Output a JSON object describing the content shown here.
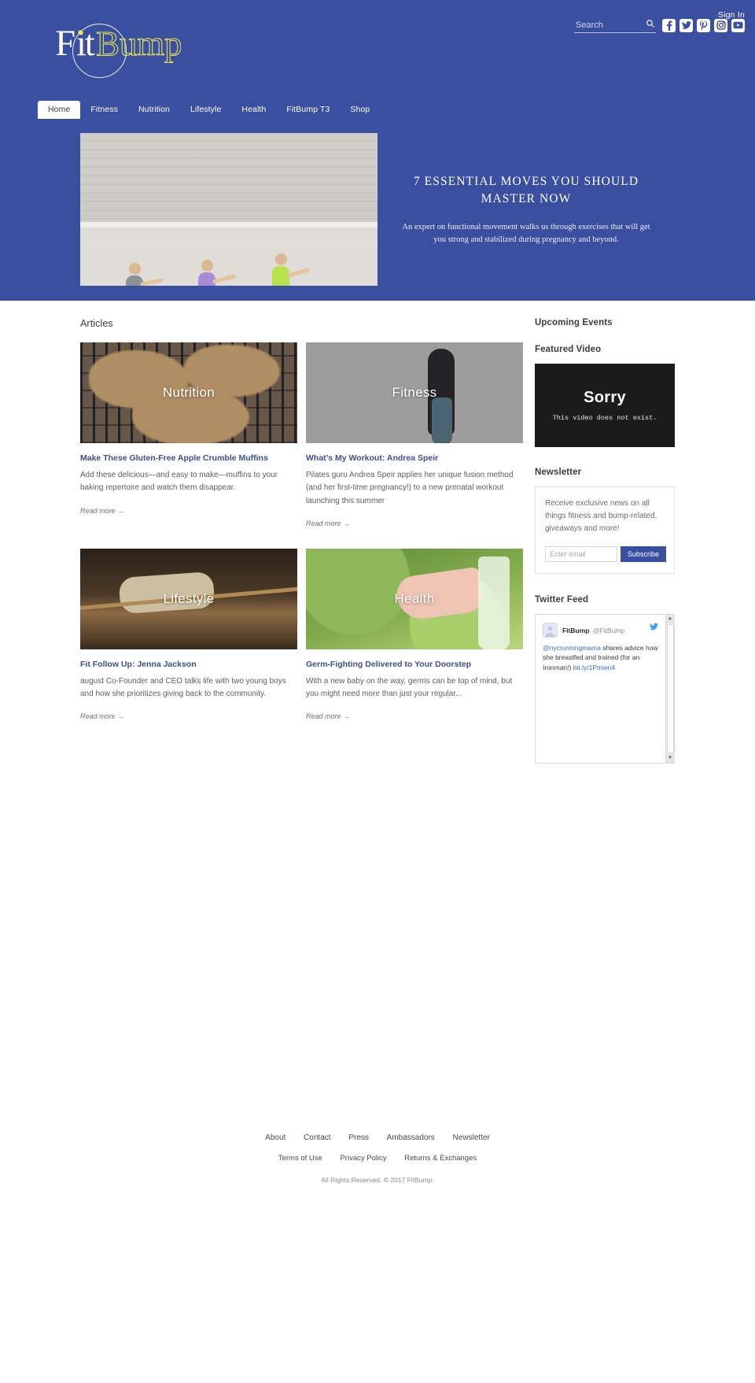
{
  "header": {
    "sign_in": "Sign In",
    "search_placeholder": "Search",
    "search_value": "",
    "search_icon": "search-icon",
    "logo_fit": "Fit",
    "logo_bump": "Bump",
    "social": [
      {
        "name": "facebook-icon",
        "label": "Facebook"
      },
      {
        "name": "twitter-icon",
        "label": "Twitter"
      },
      {
        "name": "pinterest-icon",
        "label": "Pinterest"
      },
      {
        "name": "instagram-icon",
        "label": "Instagram"
      },
      {
        "name": "youtube-icon",
        "label": "YouTube"
      }
    ]
  },
  "nav": {
    "items": [
      {
        "label": "Home",
        "active": true
      },
      {
        "label": "Fitness",
        "active": false
      },
      {
        "label": "Nutrition",
        "active": false
      },
      {
        "label": "Lifestyle",
        "active": false
      },
      {
        "label": "Health",
        "active": false
      },
      {
        "label": "FitBump T3",
        "active": false
      },
      {
        "label": "Shop",
        "active": false
      }
    ]
  },
  "hero": {
    "title": "7 ESSENTIAL MOVES YOU SHOULD MASTER NOW",
    "subtitle": "An expert on functional movement walks us through exercises that will get you strong and stabilized during pregnancy and beyond."
  },
  "articles": {
    "heading": "Articles",
    "read_more": "Read more →",
    "items": [
      {
        "category": "Nutrition",
        "title": "Make These Gluten-Free Apple Crumble Muffins",
        "desc": "Add these delicious—and easy to make—muffins to your baking repertoire and watch them disappear."
      },
      {
        "category": "Fitness",
        "title": "What’s My Workout: Andrea Speir",
        "desc": "Pilates guru Andrea Speir applies her unique fusion method (and her first-time pregnancy!) to a new prenatal workout launching this summer"
      },
      {
        "category": "Lifestyle",
        "title": "Fit Follow Up: Jenna Jackson",
        "desc": "august Co-Founder and CEO talks life with two young boys and how she prioritizes giving back to the community."
      },
      {
        "category": "Health",
        "title": "Germ-Fighting Delivered to Your Doorstep",
        "desc": "With a new baby on the way, germs can be top of mind, but you might need more than just your regular..."
      }
    ]
  },
  "sidebar": {
    "events_heading": "Upcoming Events",
    "video_heading": "Featured Video",
    "video_title": "Sorry",
    "video_message": "This video does not exist.",
    "newsletter_heading": "Newsletter",
    "newsletter_text": "Receive exclusive news on all things fitness and bump-related, giveaways and more!",
    "newsletter_placeholder": "Enter email",
    "newsletter_value": "",
    "newsletter_button": "Subscribe",
    "twitter_heading": "Twitter Feed",
    "tweet": {
      "name": "FitBump",
      "handle": "@FitBump",
      "mention": "@nycrunningmama",
      "text": " shares advice how she breastfed and trained (for an Ironman!) ",
      "link": "bit.ly/1Pmien4"
    }
  },
  "footer": {
    "primary_links": [
      "About",
      "Contact",
      "Press",
      "Ambassadors",
      "Newsletter"
    ],
    "secondary_links": [
      "Terms of Use",
      "Privacy Policy",
      "Returns & Exchanges"
    ],
    "copyright": "All Rights Reserved.  © 2017 FitBump."
  },
  "colors": {
    "brand_blue": "#3b4fa0",
    "logo_yellow": "#e8e44a",
    "link_blue": "#3b4f8f",
    "video_black": "#1c1c1c"
  }
}
